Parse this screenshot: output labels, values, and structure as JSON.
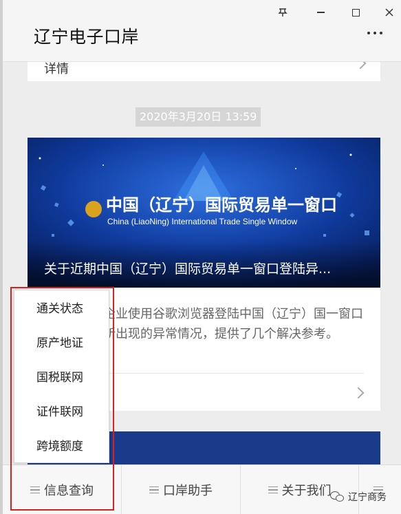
{
  "window": {
    "title": "辽宁电子口岸",
    "pin_icon": "pin-icon",
    "more_icon": "more-dots-icon"
  },
  "feed": {
    "prev_card_label": "详情",
    "timestamp": "2020年3月20日 13:59",
    "article": {
      "banner_title_cn": "中国（辽宁）国际贸易单一窗口",
      "banner_title_en": "China (LiaoNing) International Trade Single Window",
      "caption": "关于近期中国（辽宁）国际贸易单一窗口登陆异...",
      "summary": "企业使用谷歌浏览器登陆中国（辽宁）国一窗口所出现的异常情况，提供了几个解决参考。"
    }
  },
  "popup_menu": {
    "items": [
      {
        "label": "通关状态"
      },
      {
        "label": "原产地证"
      },
      {
        "label": "国税联网"
      },
      {
        "label": "证件联网"
      },
      {
        "label": "跨境额度"
      }
    ]
  },
  "tabbar": {
    "tabs": [
      {
        "label": "信息查询"
      },
      {
        "label": "口岸助手"
      },
      {
        "label": "关于我们"
      },
      {
        "label": ""
      }
    ]
  },
  "watermark": {
    "text": "辽宁商务"
  },
  "colors": {
    "highlight_border": "#d9221c",
    "banner_blue": "#0a2a78"
  }
}
